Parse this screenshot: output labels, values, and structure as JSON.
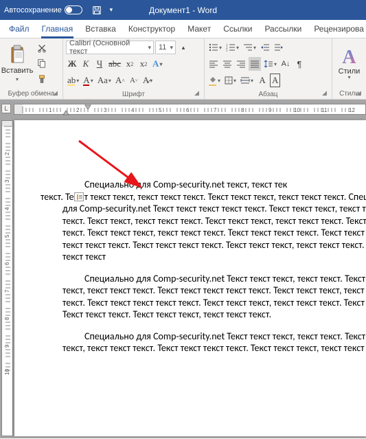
{
  "title_bar": {
    "autosave": "Автосохранение",
    "doc_title": "Документ1 - Word"
  },
  "tabs": {
    "file": "Файл",
    "home": "Главная",
    "insert": "Вставка",
    "design": "Конструктор",
    "layout": "Макет",
    "references": "Ссылки",
    "mailings": "Рассылки",
    "review": "Рецензирова"
  },
  "ribbon": {
    "clipboard": {
      "paste": "Вставить",
      "label": "Буфер обмена"
    },
    "font": {
      "name": "Calibri (Основной текст",
      "size": "11",
      "label": "Шрифт"
    },
    "paragraph": {
      "label": "Абзац"
    },
    "styles": {
      "btn": "Стили",
      "label": "Стили"
    }
  },
  "document": {
    "p1_a": "Специально для Comp-security.net текст, текст тек",
    "p1_b": "т текст текст, текст текст текст. Текст текст текст, текст текст текст. Специально для Comp-security.net Текст текст текст текст текст. Текст текст текст, текст текст текст. Текст текст, текст текст текст. Текст текст текст, текст текст текст. Текст текст текст. Текст текст текст, текст текст текст. Текст текст текст текст. Текст текст текст, текст текст текст. Текст текст текст текст. Текст текст текст, текст текст текст. Текст текст текст",
    "p1_pre": "текст. Те",
    "p2": "Специально для Comp-security.net Текст текст текст, текст текст. Текст текст текст, текст текст текст. Текст текст текст текст текст. Текст текст текст, текст текст текст. Текст текст текст текст текст. Текст текст текст, текст текст текст. Текст текст. Текст текст текст. Текст текст текст, текст текст текст.",
    "p3": "Специально для Comp-security.net Текст текст текст, текст текст. Текст текст текст, текст текст текст. Текст текст текст текст. Текст текст текст, текст текст текст."
  }
}
